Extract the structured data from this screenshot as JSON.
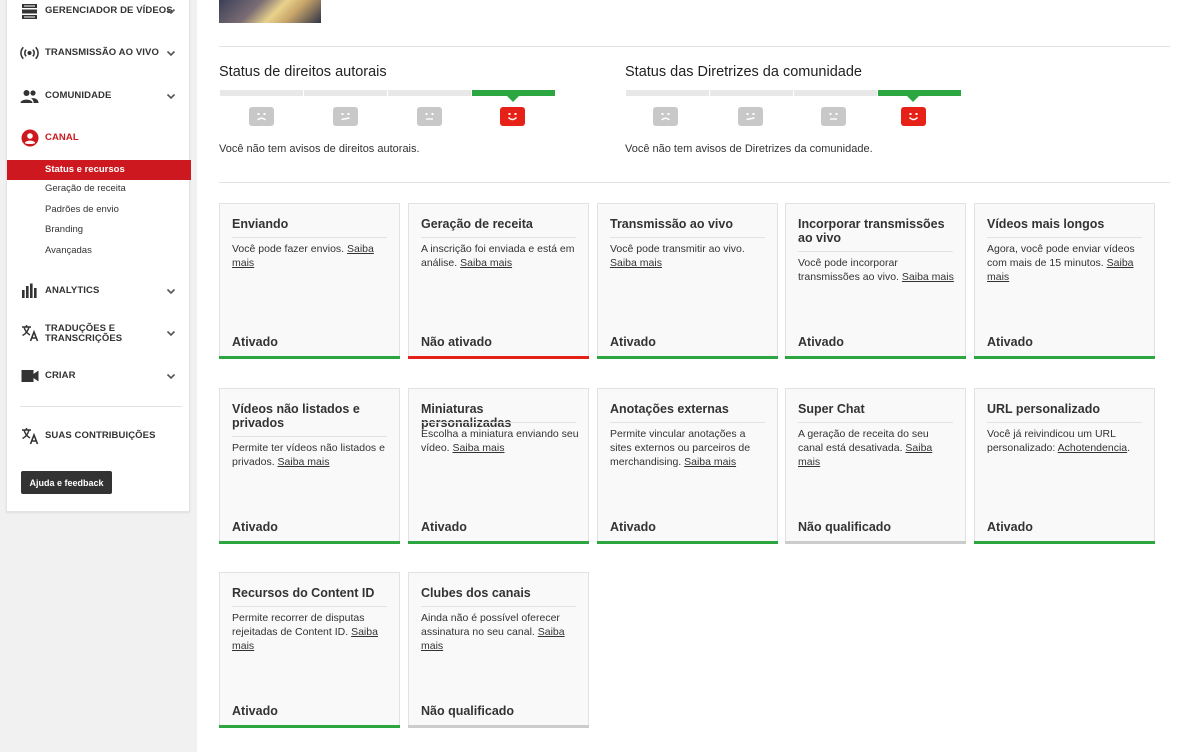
{
  "sidebar": {
    "items": [
      {
        "label": "GERENCIADOR DE VÍDEOS",
        "icon": "video-manager-icon"
      },
      {
        "label": "TRANSMISSÃO AO VIVO",
        "icon": "live-broadcast-icon"
      },
      {
        "label": "COMUNIDADE",
        "icon": "community-people-icon"
      },
      {
        "label": "CANAL",
        "icon": "channel-account-icon"
      },
      {
        "label": "ANALYTICS",
        "icon": "analytics-bars-icon"
      },
      {
        "label_line1": "TRADUÇÕES E",
        "label_line2": "TRANSCRIÇÕES",
        "icon": "translate-icon"
      },
      {
        "label": "CRIAR",
        "icon": "create-camera-icon"
      },
      {
        "label": "SUAS CONTRIBUIÇÕES",
        "icon": "contributions-translate-icon"
      }
    ],
    "channel_sub": [
      "Status e recursos",
      "Geração de receita",
      "Padrões de envio",
      "Branding",
      "Avançadas"
    ],
    "help_label": "Ajuda e feedback",
    "accent_color": "#cc181e"
  },
  "copyright": {
    "title": "Status de direitos autorais",
    "text": "Você não tem avisos de direitos autorais."
  },
  "guidelines": {
    "title": "Status das Diretrizes da comunidade",
    "text": "Você não tem avisos de Diretrizes da comunidade."
  },
  "cards": [
    {
      "title": "Enviando",
      "desc": "Você pode fazer envios.",
      "link": "Saiba mais",
      "status": "Ativado",
      "state": "green"
    },
    {
      "title": "Geração de receita",
      "desc": "A inscrição foi enviada e está em análise.",
      "link": "Saiba mais",
      "status": "Não ativado",
      "state": "red"
    },
    {
      "title": "Transmissão ao vivo",
      "desc": "Você pode transmitir ao vivo.",
      "link": "Saiba mais",
      "status": "Ativado",
      "state": "green"
    },
    {
      "title": "Incorporar transmissões ao vivo",
      "desc": "Você pode incorporar transmissões ao vivo.",
      "link": "Saiba mais",
      "status": "Ativado",
      "state": "green"
    },
    {
      "title": "Vídeos mais longos",
      "desc": "Agora, você pode enviar vídeos com mais de 15 minutos.",
      "link": "Saiba mais",
      "status": "Ativado",
      "state": "green"
    },
    {
      "title": "Vídeos não listados e privados",
      "desc": "Permite ter vídeos não listados e privados.",
      "link": "Saiba mais",
      "status": "Ativado",
      "state": "green"
    },
    {
      "title": "Miniaturas personalizadas",
      "desc": "Escolha a miniatura enviando seu vídeo.",
      "link": "Saiba mais",
      "status": "Ativado",
      "state": "green"
    },
    {
      "title": "Anotações externas",
      "desc": "Permite vincular anotações a sites externos ou parceiros de merchandising.",
      "link": "Saiba mais",
      "status": "Ativado",
      "state": "green"
    },
    {
      "title": "Super Chat",
      "desc": "A geração de receita do seu canal está desativada.",
      "link": "Saiba mais",
      "status": "Não qualificado",
      "state": "gray"
    },
    {
      "title": "URL personalizado",
      "desc": "Você já reivindicou um URL personalizado:",
      "link": "Achotendencia",
      "suffix": ".",
      "status": "Ativado",
      "state": "green"
    },
    {
      "title": "Recursos do Content ID",
      "desc": "Permite recorrer de disputas rejeitadas de Content ID.",
      "link": "Saiba mais",
      "status": "Ativado",
      "state": "green"
    },
    {
      "title": "Clubes dos canais",
      "desc": "Ainda não é possível oferecer assinatura no seu canal.",
      "link": "Saiba mais",
      "status": "Não qualificado",
      "state": "gray"
    }
  ],
  "colors": {
    "green": "#2ba640",
    "red": "#e62117",
    "gray": "#cccccc"
  }
}
